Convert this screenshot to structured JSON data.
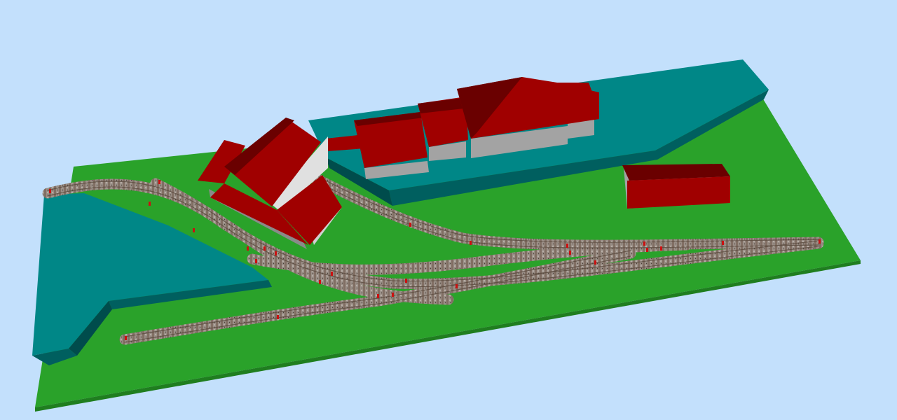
{
  "scene": {
    "kind": "3d-model-railway-layout",
    "colors": {
      "sky": "#c3e0fc",
      "baseboard": "#2aa22a",
      "baseboard_edge": "#1f7e1f",
      "terrain_top": "#008787",
      "terrain_side": "#005f5f",
      "terrain_side_dark": "#004c4c",
      "roof_light": "#a00000",
      "roof_dark": "#6a0000",
      "wall": "#a3a3a3",
      "wall_dark": "#8a8a8a",
      "ballast": "#9b9088",
      "rail": "#5a4a3e",
      "sleeper": "#6b5446",
      "track_joint": "#cc1010"
    },
    "objects": [
      {
        "name": "baseboard",
        "icon": "green-plane"
      },
      {
        "name": "left-hill",
        "icon": "teal-plateau"
      },
      {
        "name": "rear-plateau",
        "icon": "teal-plateau"
      },
      {
        "name": "station-building",
        "icon": "red-roof-building"
      },
      {
        "name": "goods-shed",
        "icon": "red-roof-building"
      },
      {
        "name": "engine-shed",
        "icon": "red-roof-building"
      },
      {
        "name": "small-shed",
        "icon": "red-roof-building"
      },
      {
        "name": "track-network",
        "icon": "railway-track"
      }
    ]
  }
}
